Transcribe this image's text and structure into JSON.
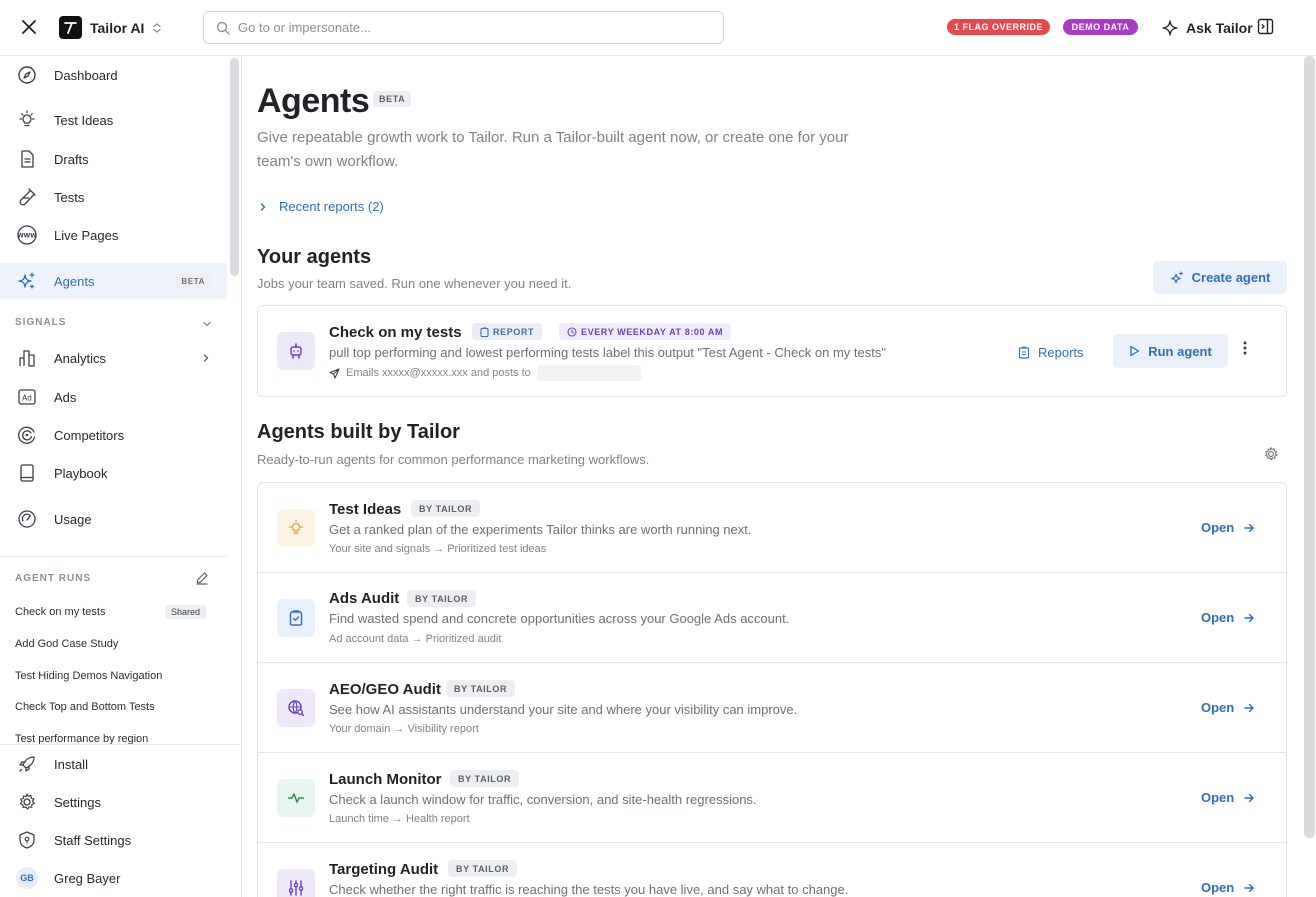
{
  "topbar": {
    "workspace_name": "Tailor AI",
    "search_placeholder": "Go to or impersonate...",
    "flag_pill": "1 FLAG OVERRIDE",
    "demo_pill": "DEMO DATA",
    "ask_label": "Ask Tailor",
    "colors": {
      "flag": "#e5484d",
      "demo": "#a93bc7"
    }
  },
  "sidebar": {
    "items": [
      {
        "label": "Dashboard",
        "icon": "compass-icon"
      },
      {
        "label": "Test Ideas",
        "icon": "lightbulb-icon"
      },
      {
        "label": "Drafts",
        "icon": "document-icon"
      },
      {
        "label": "Tests",
        "icon": "flask-icon"
      },
      {
        "label": "Live Pages",
        "icon": "www-icon"
      },
      {
        "label": "Agents",
        "icon": "sparkles-icon",
        "badge": "BETA",
        "active": true
      }
    ],
    "signals_label": "SIGNALS",
    "signal_items": [
      {
        "label": "Analytics",
        "icon": "bar-chart-icon"
      },
      {
        "label": "Ads",
        "icon": "ad-icon"
      },
      {
        "label": "Competitors",
        "icon": "radar-icon"
      },
      {
        "label": "Playbook",
        "icon": "book-icon"
      }
    ],
    "usage_label": "Usage",
    "agent_runs_label": "AGENT RUNS",
    "agent_runs": [
      {
        "label": "Check on my tests",
        "badge": "Shared"
      },
      {
        "label": "Add God Case Study"
      },
      {
        "label": "Test Hiding Demos Navigation"
      },
      {
        "label": "Check Top and Bottom Tests"
      },
      {
        "label": "Test performance by region"
      }
    ],
    "bottom": {
      "install": "Install",
      "settings": "Settings",
      "staff_settings": "Staff Settings",
      "user_name": "Greg Bayer",
      "user_initials": "GB"
    }
  },
  "main": {
    "title": "Agents",
    "title_badge": "BETA",
    "subtitle": "Give repeatable growth work to Tailor. Run a Tailor-built agent now, or create one for your team's own workflow.",
    "recent_reports": "Recent reports (2)",
    "your_agents": {
      "heading": "Your agents",
      "sub": "Jobs your team saved. Run one whenever you need it.",
      "create_label": "Create agent",
      "agent": {
        "name": "Check on my tests",
        "tag_report": "REPORT",
        "tag_schedule": "EVERY WEEKDAY AT 8:00 AM",
        "description": "pull top performing and lowest performing tests label this output \"Test Agent - Check on my tests\"",
        "meta": "Emails xxxxx@xxxxx.xxx and posts to",
        "reports_label": "Reports",
        "run_label": "Run agent"
      }
    },
    "built": {
      "heading": "Agents built by Tailor",
      "sub": "Ready-to-run agents for common performance marketing workflows.",
      "tag": "BY TAILOR",
      "open_label": "Open",
      "agents": [
        {
          "name": "Test Ideas",
          "description": "Get a ranked plan of the experiments Tailor thinks are worth running next.",
          "flow": "Your site and signals → Prioritized test ideas",
          "icon": "lightbulb-icon",
          "bg": "#fdf3e3",
          "color": "#e0a341"
        },
        {
          "name": "Ads Audit",
          "description": "Find wasted spend and concrete opportunities across your Google Ads account.",
          "flow": "Ad account data → Prioritized audit",
          "icon": "clipboard-check-icon",
          "bg": "#e8f0fb",
          "color": "#3b6db3"
        },
        {
          "name": "AEO/GEO Audit",
          "description": "See how AI assistants understand your site and where your visibility can improve.",
          "flow": "Your domain → Visibility report",
          "icon": "globe-search-icon",
          "bg": "#efe8fb",
          "color": "#6a3fc1"
        },
        {
          "name": "Launch Monitor",
          "description": "Check a launch window for traffic, conversion, and site-health regressions.",
          "flow": "Launch time → Health report",
          "icon": "pulse-icon",
          "bg": "#e6f5ed",
          "color": "#2f8f5b"
        },
        {
          "name": "Targeting Audit",
          "description": "Check whether the right traffic is reaching the tests you have live, and say what to change.",
          "flow": "",
          "icon": "sliders-icon",
          "bg": "#efe8fb",
          "color": "#6a3fc1"
        }
      ]
    }
  }
}
